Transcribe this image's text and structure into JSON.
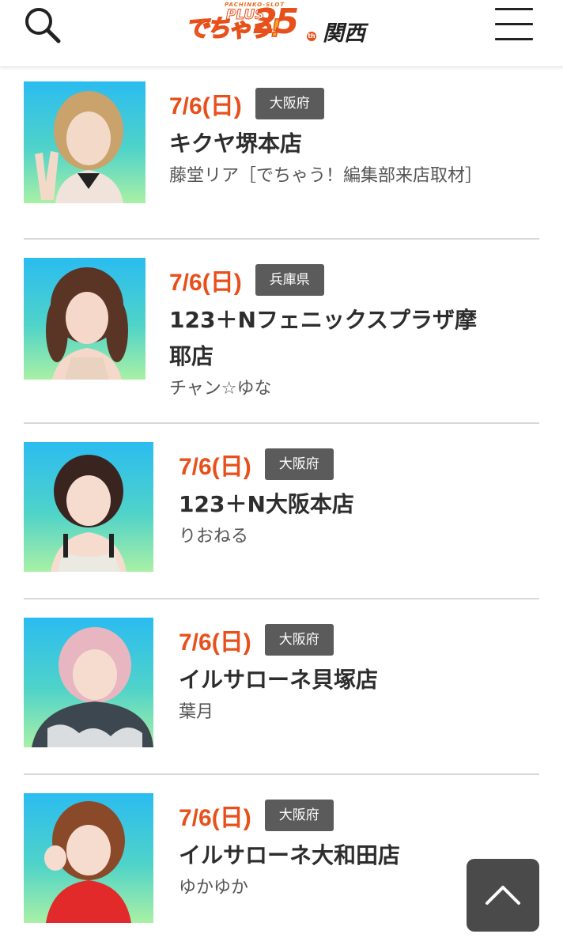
{
  "header": {
    "search_icon": "search-icon",
    "menu_icon": "hamburger-menu-icon",
    "logo": {
      "small_text": "PACHINKO-SLOT",
      "plus": "PLUS",
      "main": "でちゃう!",
      "number": "25",
      "mark": "th",
      "region": "関西"
    }
  },
  "entries": [
    {
      "date": "7/6(日)",
      "prefecture": "大阪府",
      "store": "キクヤ堺本店",
      "talent": "藤堂リア［でちゃう！編集部来店取材］"
    },
    {
      "date": "7/6(日)",
      "prefecture": "兵庫県",
      "store": "123＋Nフェニックスプラザ摩耶店",
      "talent": "チャン☆ゆな"
    },
    {
      "date": "7/6(日)",
      "prefecture": "大阪府",
      "store": "123＋N大阪本店",
      "talent": "りおねる"
    },
    {
      "date": "7/6(日)",
      "prefecture": "大阪府",
      "store": "イルサローネ貝塚店",
      "talent": "葉月"
    },
    {
      "date": "7/6(日)",
      "prefecture": "大阪府",
      "store": "イルサローネ大和田店",
      "talent": "ゆかゆか"
    }
  ],
  "scroll_top_icon": "chevron-up-icon",
  "colors": {
    "accent": "#e8501b",
    "badge": "#5b5b5b",
    "divider": "#d8d8d8",
    "scroll_button": "#4a4a4a"
  }
}
